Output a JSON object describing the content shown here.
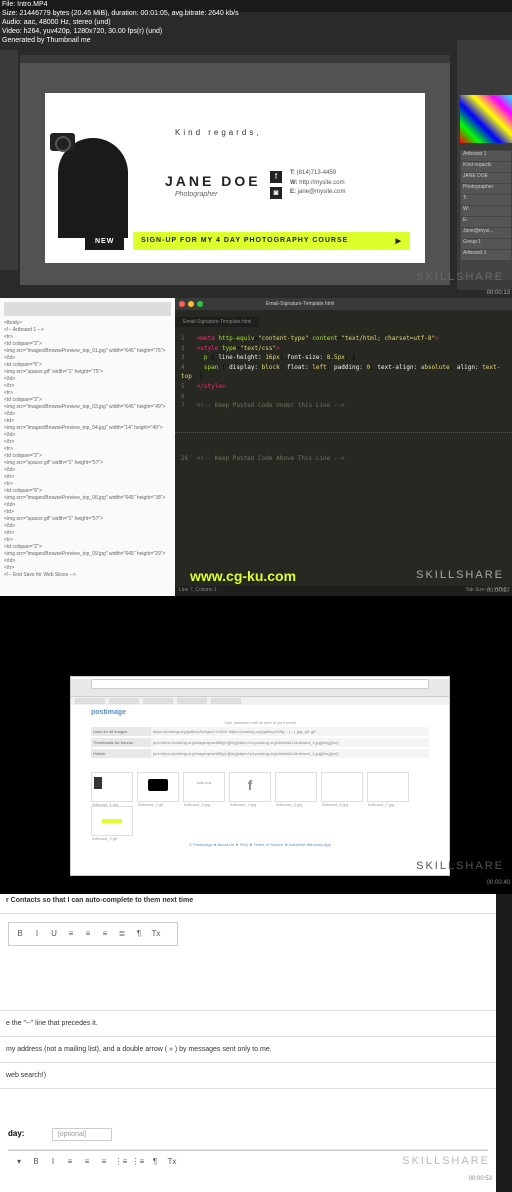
{
  "fileinfo": {
    "filename": "File: Intro.MP4",
    "size": "Size: 21446779 bytes (20.45 MiB), duration: 00:01:05, avg.bitrate: 2640 kb/s",
    "audio": "Audio: aac, 48000 Hz, stereo (und)",
    "video": "Video: h264, yuv420p, 1280x720, 30.00 fps(r) (und)",
    "generated": "Generated by Thumbnail me"
  },
  "watermark": "SKILLSHARE",
  "timestamps": [
    "00:00:13",
    "00:00:27",
    "00:00:40",
    "00:00:53"
  ],
  "signature": {
    "tagline": "Kind regards,",
    "name": "JANE DOE",
    "role": "Photographer",
    "phone_label": "T:",
    "phone": "(814)713-4459",
    "web_label": "W:",
    "web": "http://mysite.com",
    "email_label": "E:",
    "email": "jane@mysite.com",
    "new_badge": "NEW",
    "cta": "SIGN-UP FOR MY 4 DAY PHOTOGRAPHY COURSE",
    "cta_arrow": "▶"
  },
  "ps": {
    "layers": [
      "Artboard 1",
      "Kind regards",
      "JANE DOE",
      "Photographer",
      "T:",
      "W:",
      "E:",
      "Jane@mysi...",
      "Group 1",
      "Artboard 1"
    ]
  },
  "sublime": {
    "title": "Email-Signature-Template.html",
    "tab": "Email-Signature-Template.html",
    "lines": [
      {
        "n": "1",
        "html": "<span class='c-pink'>&lt;meta</span> <span class='c-green'>http-equiv</span>=<span class='c-yellow'>\"content-type\"</span> <span class='c-green'>content</span>=<span class='c-yellow'>\"text/html; charset=utf-8\"</span><span class='c-pink'>&gt;</span>"
      },
      {
        "n": "2",
        "html": "<span class='c-pink'>&lt;style</span> <span class='c-green'>type</span>=<span class='c-yellow'>\"text/css\"</span><span class='c-pink'>&gt;</span>"
      },
      {
        "n": "3",
        "html": "&nbsp;&nbsp;<span class='c-green'>p</span> { <span class='c-white'>line-height:</span> <span class='c-yellow'>16px</span>; <span class='c-white'>font-size:</span> <span class='c-yellow'>8.5px</span>; }"
      },
      {
        "n": "4",
        "html": "&nbsp;&nbsp;<span class='c-green'>span</span> { <span class='c-white'>display:</span> <span class='c-yellow'>block</span>; <span class='c-white'>float:</span> <span class='c-yellow'>left</span>; <span class='c-white'>padding:</span> <span class='c-yellow'>0</span>; <span class='c-white'>text-align:</span> <span class='c-yellow'>absolute</span>; <span class='c-white'>align:</span> <span class='c-yellow'>text-top</span>; }"
      },
      {
        "n": "5",
        "html": "<span class='c-pink'>&lt;/style&gt;</span>"
      },
      {
        "n": "6",
        "html": ""
      },
      {
        "n": "7",
        "html": "<span class='c-mute'>&lt;!-- Keep Pasted Code Under this Line --&gt;</span>"
      }
    ],
    "comment2": "<!-- Keep Pasted Code Above This Line -->",
    "status_left": "Line 7, Column 1",
    "status_right_tabs": "Tab Size: 4",
    "status_right_lang": "HTML"
  },
  "dw": {
    "code_lines": [
      "<tbody>",
      "<!-- Artboard 1 -->",
      "<tr>",
      "  <td colspan=\"2\">",
      "    <img src=\"images/BrowsePreview_top_01.jpg\" width=\"645\" height=\"75\">",
      "  </td>",
      "  <td colspan=\"6\">",
      "    <img src=\"spacer.gif\" width=\"1\" height=\"75\">",
      "  </td>",
      "</tr>",
      "<tr>",
      "  <td colspan=\"2\">",
      "    <img src=\"images/BrowsePreview_top_03.jpg\" width=\"645\" height=\"49\">",
      "  </td>",
      "  <td>",
      "    <img src=\"images/BrowsePreview_top_04.jpg\" width=\"14\" height=\"49\">",
      "  </td>",
      "</tr>",
      "<tr>",
      "  <td colspan=\"2\">",
      "    <img src=\"spacer.gif\" width=\"1\" height=\"57\">",
      "  </td>",
      "</tr>",
      "<tr>",
      "  <td colspan=\"6\">",
      "    <img src=\"images/BrowsePreview_top_06.jpg\" width=\"645\" height=\"38\">",
      "  </td>",
      "  <td>",
      "    <img src=\"spacer.gif\" width=\"1\" height=\"57\">",
      "  </td>",
      "</tr>",
      "<tr>",
      "  <td colspan=\"2\">",
      "    <img src=\"images/BrowsePreview_top_09.jpg\" width=\"645\" height=\"29\">",
      "  </td>",
      "</tr>",
      "<!-- End Save for Web Slices -->"
    ]
  },
  "bottom_url": "www.cg-ku.com",
  "postimage": {
    "logo": "postimage",
    "note": "Your password will be sent to your email",
    "rows": [
      {
        "label": "Links for all images",
        "value": "https://postimg.org/gallery/3n5gm/c7e524/  https://postimg.org/gallery/3n5g...  (...) .jpg .gif .gif"
      },
      {
        "label": "Thumbnails for forums",
        "value": "[url=https://postimg.org/image/qnset6f0g1/][img]https://s4.postimg.org/c6wbw61/Artboard_1.jpg[/img][/url]"
      },
      {
        "label": "Hotlink",
        "value": "[url=https://postimg.org/image/qnset6f0g1/][img]https://s4.postimg.org/c6wbw61/Artboard_1.jpg[/img][/url]"
      }
    ],
    "thumbs": [
      {
        "label": "Artboard_1.jpg",
        "inner": "sig"
      },
      {
        "label": "Artboard_2.gif",
        "inner": "black"
      },
      {
        "label": "Artboard_3.jpg",
        "inner": "name"
      },
      {
        "label": "Artboard_4.jpg",
        "inner": "f"
      },
      {
        "label": "Artboard_5.jpg",
        "inner": "dots"
      },
      {
        "label": "Artboard_6.jpg",
        "inner": "dots"
      },
      {
        "label": "Artboard_7.jpg",
        "inner": "blank"
      },
      {
        "label": "Artboard_2.gif",
        "inner": "yellow"
      }
    ],
    "footer": "© Postimage   ★ About Us   ★ FAQ   ★ Terms of Service   ★ Advertise   Windows App"
  },
  "gmail": {
    "contacts_line": "r Contacts so that I can auto-complete to them next time",
    "rte_buttons": [
      "B",
      "I",
      "U",
      "≡",
      "≡",
      "≡",
      "≣",
      "¶",
      "Tx"
    ],
    "sig_note1": "e the \"--\" line that precedes it.",
    "sig_note2": "my address (not a mailing list), and a double arrow ( » ) by messages sent only to me.",
    "sig_note3": "web search!)",
    "vacation_label": "day:",
    "vacation_placeholder": "(optional)",
    "rte2_buttons": [
      "▾",
      "B",
      "I",
      "≡",
      "≡",
      "≡",
      "⋮≡",
      "⋮≡",
      "¶",
      "Tx"
    ]
  }
}
